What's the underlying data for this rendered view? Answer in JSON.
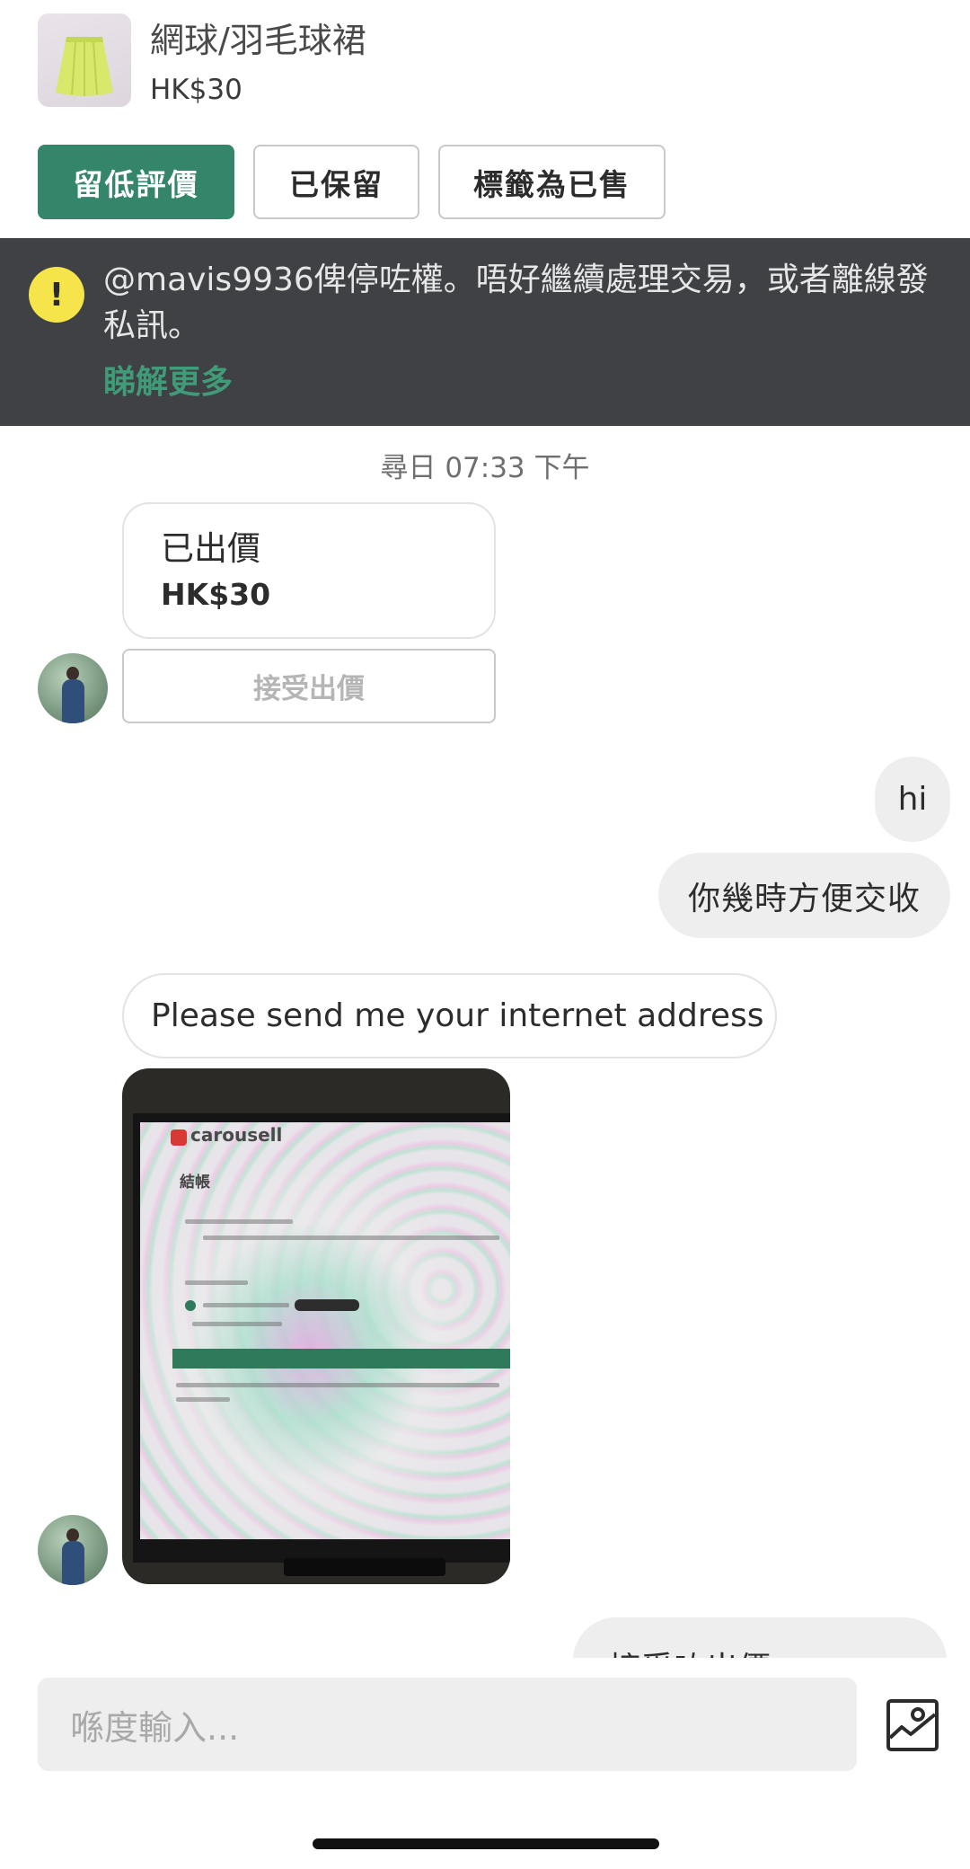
{
  "listing": {
    "title": "網球/羽毛球裙",
    "price": "HK$30",
    "thumbnail_icon": "skirt-image"
  },
  "actions": {
    "leave_review": "留低評價",
    "reserved": "已保留",
    "mark_sold": "標籤為已售"
  },
  "banner": {
    "icon": "exclamation-icon",
    "message": "@mavis9936俾停咗權。唔好繼續處理交易，或者離線發私訊。",
    "link": "睇解更多"
  },
  "chat": {
    "date_separator": "尋日 07:33 下午",
    "offer": {
      "label": "已出價",
      "amount": "HK$30",
      "accept_button": "接受出價"
    },
    "messages": [
      {
        "side": "out",
        "text": "hi"
      },
      {
        "side": "out",
        "text": "你幾時方便交收"
      },
      {
        "side": "in",
        "text": "Please send me your internet address"
      },
      {
        "side": "in",
        "type": "image",
        "photo": {
          "brand": "carousell",
          "heading": "結帳"
        }
      },
      {
        "side": "out",
        "text": "接受咗出價"
      }
    ]
  },
  "composer": {
    "placeholder": "喺度輸入...",
    "image_icon": "image-upload-icon"
  },
  "colors": {
    "accent_green": "#35856a",
    "banner_bg": "#3f4144",
    "warning_yellow": "#f6e44b",
    "link_green": "#3f9b78"
  }
}
